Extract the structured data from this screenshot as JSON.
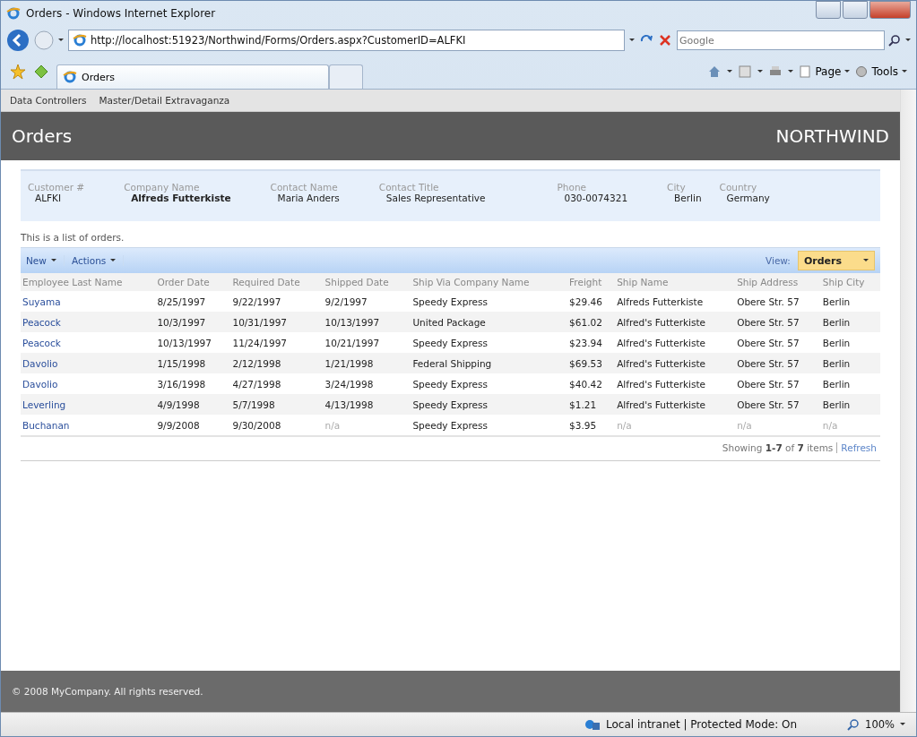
{
  "window": {
    "title": "Orders - Windows Internet Explorer"
  },
  "address_bar": {
    "url": "http://localhost:51923/Northwind/Forms/Orders.aspx?CustomerID=ALFKI"
  },
  "search": {
    "placeholder": "Google"
  },
  "tab": {
    "label": "Orders",
    "selected": true
  },
  "command_bar": [
    "Page",
    "Tools"
  ],
  "menu": [
    "Data Controllers",
    "Master/Detail Extravaganza"
  ],
  "header": {
    "title": "Orders",
    "brand": "NORTHWIND"
  },
  "customer": [
    {
      "label": "Customer #",
      "value": "ALFKI",
      "bold": false
    },
    {
      "label": "Company Name",
      "value": "Alfreds Futterkiste",
      "bold": true
    },
    {
      "label": "Contact Name",
      "value": "Maria Anders",
      "bold": false
    },
    {
      "label": "Contact Title",
      "value": "Sales Representative",
      "bold": false
    },
    {
      "label": "Phone",
      "value": "030-0074321",
      "bold": false
    },
    {
      "label": "City",
      "value": "Berlin",
      "bold": false
    },
    {
      "label": "Country",
      "value": "Germany",
      "bold": false
    }
  ],
  "description": "This is a list of orders.",
  "toolbar": {
    "actions": [
      "New",
      "Actions"
    ],
    "view_label": "View:",
    "view": "Orders"
  },
  "table": {
    "columns": [
      "Employee Last Name",
      "Order Date",
      "Required Date",
      "Shipped Date",
      "Ship Via Company Name",
      "Freight",
      "Ship Name",
      "Ship Address",
      "Ship City"
    ],
    "rows": [
      [
        "Suyama",
        "8/25/1997",
        "9/22/1997",
        "9/2/1997",
        "Speedy Express",
        "$29.46",
        "Alfreds Futterkiste",
        "Obere Str. 57",
        "Berlin"
      ],
      [
        "Peacock",
        "10/3/1997",
        "10/31/1997",
        "10/13/1997",
        "United Package",
        "$61.02",
        "Alfred's Futterkiste",
        "Obere Str. 57",
        "Berlin"
      ],
      [
        "Peacock",
        "10/13/1997",
        "11/24/1997",
        "10/21/1997",
        "Speedy Express",
        "$23.94",
        "Alfred's Futterkiste",
        "Obere Str. 57",
        "Berlin"
      ],
      [
        "Davolio",
        "1/15/1998",
        "2/12/1998",
        "1/21/1998",
        "Federal Shipping",
        "$69.53",
        "Alfred's Futterkiste",
        "Obere Str. 57",
        "Berlin"
      ],
      [
        "Davolio",
        "3/16/1998",
        "4/27/1998",
        "3/24/1998",
        "Speedy Express",
        "$40.42",
        "Alfred's Futterkiste",
        "Obere Str. 57",
        "Berlin"
      ],
      [
        "Leverling",
        "4/9/1998",
        "5/7/1998",
        "4/13/1998",
        "Speedy Express",
        "$1.21",
        "Alfred's Futterkiste",
        "Obere Str. 57",
        "Berlin"
      ],
      [
        "Buchanan",
        "9/9/2008",
        "9/30/2008",
        {
          "text": "n/a",
          "greyed": true
        },
        "Speedy Express",
        "$3.95",
        {
          "text": "n/a",
          "greyed": true
        },
        {
          "text": "n/a",
          "greyed": true
        },
        {
          "text": "n/a",
          "greyed": true
        }
      ]
    ],
    "pager": "Showing **1-7** of **7** items",
    "refresh": "Refresh"
  },
  "footer": "© 2008 MyCompany. All rights reserved.",
  "status_bar": {
    "zone": "Local intranet | Protected Mode: On",
    "zoom": "100%"
  }
}
